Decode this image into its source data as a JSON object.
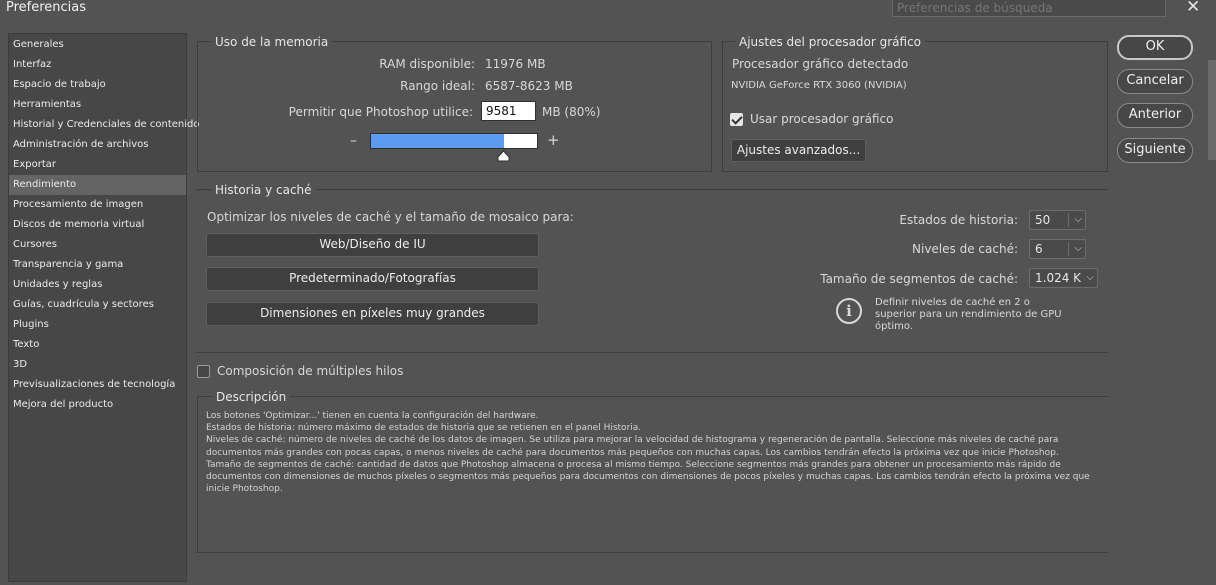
{
  "window": {
    "title": "Preferencias",
    "search_placeholder": "Preferencias de búsqueda",
    "close_glyph": "✕"
  },
  "sidebar": {
    "items": [
      {
        "label": "Generales",
        "active": false
      },
      {
        "label": "Interfaz",
        "active": false
      },
      {
        "label": "Espacio de trabajo",
        "active": false
      },
      {
        "label": "Herramientas",
        "active": false
      },
      {
        "label": "Historial y Credenciales de contenido",
        "active": false
      },
      {
        "label": "Administración de archivos",
        "active": false
      },
      {
        "label": "Exportar",
        "active": false
      },
      {
        "label": "Rendimiento",
        "active": true
      },
      {
        "label": "Procesamiento de imagen",
        "active": false
      },
      {
        "label": "Discos de memoria virtual",
        "active": false
      },
      {
        "label": "Cursores",
        "active": false
      },
      {
        "label": "Transparencia y gama",
        "active": false
      },
      {
        "label": "Unidades y reglas",
        "active": false
      },
      {
        "label": "Guías, cuadrícula y sectores",
        "active": false
      },
      {
        "label": "Plugins",
        "active": false
      },
      {
        "label": "Texto",
        "active": false
      },
      {
        "label": "3D",
        "active": false
      },
      {
        "label": "Previsualizaciones de tecnología",
        "active": false
      },
      {
        "label": "Mejora del producto",
        "active": false
      }
    ]
  },
  "memory": {
    "legend": "Uso de la memoria",
    "ram_label": "RAM disponible:",
    "ram_value": "11976 MB",
    "range_label": "Rango ideal:",
    "range_value": "6587-8623 MB",
    "allow_label": "Permitir que Photoshop utilice:",
    "allow_value": "9581",
    "allow_unit": "MB (80%)",
    "minus": "–",
    "plus": "+",
    "slider_fraction": 0.8
  },
  "gpu": {
    "legend": "Ajustes del procesador gráfico",
    "detected_label": "Procesador gráfico detectado",
    "gpu_name": "NVIDIA GeForce RTX 3060 (NVIDIA)",
    "use_gpu_label": "Usar procesador gráfico",
    "use_gpu_checked": true,
    "advanced_button": "Ajustes avanzados..."
  },
  "history_cache": {
    "legend": "Historia y caché",
    "optimize_label": "Optimizar los niveles de caché y el tamaño de mosaico para:",
    "buttons": [
      "Web/Diseño de IU",
      "Predeterminado/Fotografías",
      "Dimensiones en píxeles muy grandes"
    ],
    "history_states_label": "Estados de historia:",
    "history_states_value": "50",
    "cache_levels_label": "Niveles de caché:",
    "cache_levels_value": "6",
    "tile_size_label": "Tamaño de segmentos de caché:",
    "tile_size_value": "1.024 K",
    "info_text": [
      "Definir niveles de caché en 2 o",
      "superior para un rendimiento de GPU",
      "óptimo."
    ],
    "info_glyph": "i"
  },
  "multithread": {
    "label": "Composición de múltiples hilos",
    "checked": false
  },
  "description": {
    "legend": "Descripción",
    "lines": [
      "Los botones 'Optimizar...' tienen en cuenta la configuración del hardware.",
      "Estados de historia: número máximo de estados de historia que se retienen en el panel Historia.",
      "Niveles de caché: número de niveles de caché de los datos de imagen. Se utiliza para mejorar la velocidad de histograma y regeneración de pantalla. Seleccione más niveles de caché para",
      "documentos más grandes con pocas capas, o menos niveles de caché para documentos más pequeños con muchas capas. Los cambios tendrán efecto la próxima vez que inicie Photoshop.",
      "Tamaño de segmentos de caché: cantidad de datos que Photoshop almacena o procesa al mismo tiempo. Seleccione segmentos más grandes para obtener un procesamiento más rápido de",
      "documentos con dimensiones de muchos píxeles o segmentos más pequeños para documentos con dimensiones de pocos píxeles y muchas capas. Los cambios tendrán efecto la próxima vez que",
      "inicie Photoshop."
    ]
  },
  "actions": {
    "ok": "OK",
    "cancel": "Cancelar",
    "previous": "Anterior",
    "next": "Siguiente"
  },
  "colors": {
    "background": "#535353",
    "slider_fill": "#5b9cf0",
    "sidebar_active": "#646464"
  }
}
